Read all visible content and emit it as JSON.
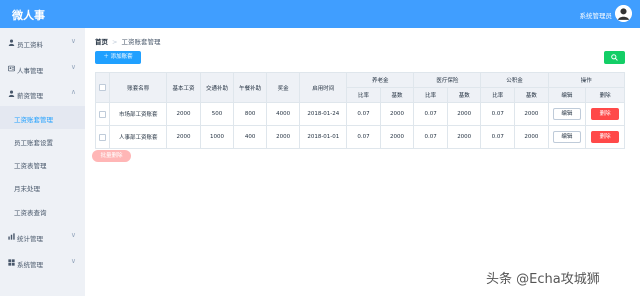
{
  "header": {
    "app_title": "微人事",
    "user_name": "系统管理员",
    "bg_color": "#409eff"
  },
  "sidebar": {
    "groups": [
      {
        "label": "员工资料",
        "icon": "person-icon"
      },
      {
        "label": "人事管理",
        "icon": "person-card-icon"
      },
      {
        "label": "薪资管理",
        "icon": "person-icon",
        "expanded": true,
        "items": [
          {
            "label": "工资账套管理",
            "active": true
          },
          {
            "label": "员工账套设置"
          },
          {
            "label": "工资表管理"
          },
          {
            "label": "月末处理"
          },
          {
            "label": "工资表查询"
          }
        ]
      },
      {
        "label": "统计管理",
        "icon": "bar-chart-icon"
      },
      {
        "label": "系统管理",
        "icon": "windows-icon"
      }
    ],
    "chevron_down": "∨",
    "chevron_up": "∧"
  },
  "breadcrumb": {
    "home": "首页",
    "sep": ">",
    "current": "工资账套管理"
  },
  "toolbar": {
    "add_label": "添加账套",
    "add_icon": "＋"
  },
  "table": {
    "headers": {
      "name": "账套名称",
      "basic": "基本工资",
      "traffic": "交通补助",
      "lunch": "午餐补助",
      "bonus": "奖金",
      "date": "启用时间",
      "pension": "养老金",
      "medical": "医疗保险",
      "fund": "公积金",
      "ratio": "比率",
      "base": "基数",
      "ops": "操作",
      "edit": "编辑",
      "del": "删除"
    },
    "rows": [
      {
        "name": "市场部工资账套",
        "basic": "2000",
        "traffic": "500",
        "lunch": "800",
        "bonus": "4000",
        "date": "2018-01-24",
        "p_ratio": "0.07",
        "p_base": "2000",
        "m_ratio": "0.07",
        "m_base": "2000",
        "f_ratio": "0.07",
        "f_base": "2000",
        "edit": "编辑",
        "del": "删除"
      },
      {
        "name": "人事部工资账套",
        "basic": "2000",
        "traffic": "1000",
        "lunch": "400",
        "bonus": "2000",
        "date": "2018-01-01",
        "p_ratio": "0.07",
        "p_base": "2000",
        "m_ratio": "0.07",
        "m_base": "2000",
        "f_ratio": "0.07",
        "f_base": "2000",
        "edit": "编辑",
        "del": "删除"
      }
    ]
  },
  "batch_delete_label": "批量删除",
  "watermark": "头条 @Echa攻城狮"
}
